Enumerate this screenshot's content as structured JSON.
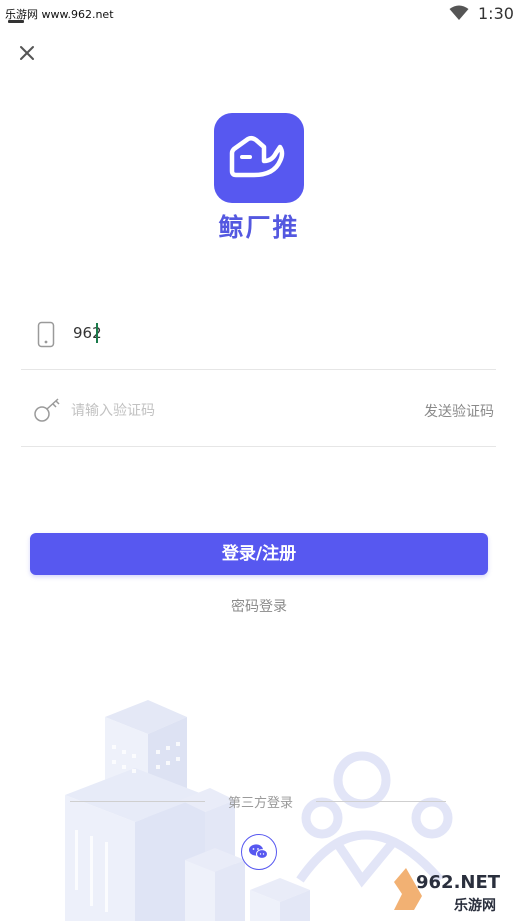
{
  "status_bar": {
    "watermark": "乐游网 www.962.net",
    "time": "1:30"
  },
  "app": {
    "name": "鲸厂推"
  },
  "form": {
    "phone_value": "962",
    "code_placeholder": "请输入验证码",
    "send_code_label": "发送验证码"
  },
  "actions": {
    "login_label": "登录/注册",
    "password_login_label": "密码登录"
  },
  "third_party": {
    "label": "第三方登录",
    "providers": [
      "wechat-icon"
    ]
  },
  "footer_watermark": {
    "brand": "962.NET",
    "sub": "乐游网"
  },
  "colors": {
    "accent": "#5758f0",
    "brand_text": "#5458e0"
  }
}
